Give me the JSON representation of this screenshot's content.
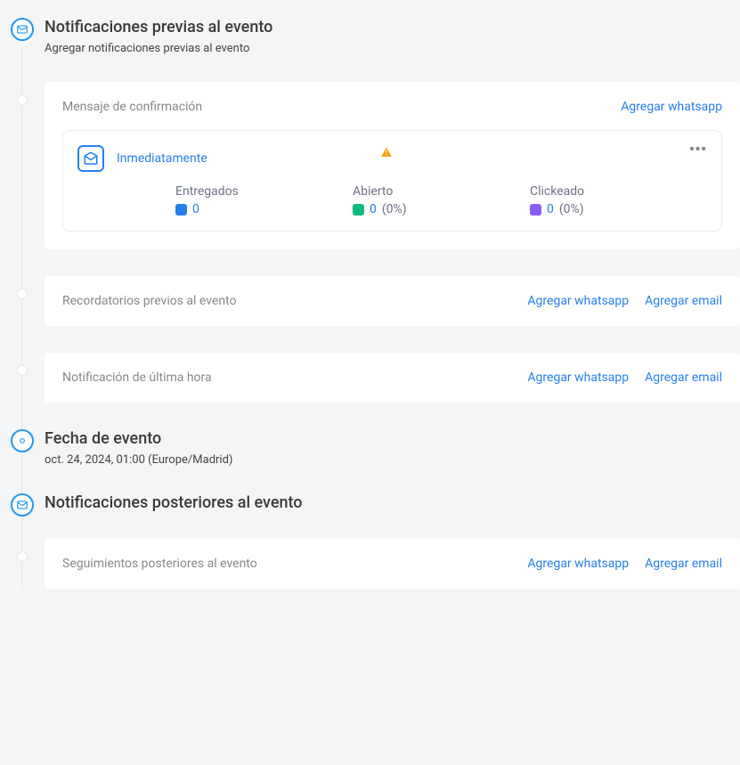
{
  "sections": {
    "pre": {
      "title": "Notificaciones previas al evento",
      "subtitle": "Agregar notificaciones previas al evento"
    },
    "event": {
      "title": "Fecha de evento",
      "date": "oct. 24, 2024, 01:00 (Europe/Madrid)"
    },
    "post": {
      "title": "Notificaciones posteriores al evento"
    }
  },
  "cards": {
    "confirmation": {
      "title": "Mensaje de confirmación",
      "add_whatsapp": "Agregar whatsapp"
    },
    "reminders": {
      "title": "Recordatorios previos al evento",
      "add_whatsapp": "Agregar whatsapp",
      "add_email": "Agregar email"
    },
    "last_minute": {
      "title": "Notificación de última hora",
      "add_whatsapp": "Agregar whatsapp",
      "add_email": "Agregar email"
    },
    "followups": {
      "title": "Seguimientos posteriores al evento",
      "add_whatsapp": "Agregar whatsapp",
      "add_email": "Agregar email"
    }
  },
  "message": {
    "timing": "Inmediatamente",
    "stats": {
      "delivered": {
        "label": "Entregados",
        "value": "0"
      },
      "opened": {
        "label": "Abierto",
        "value": "0",
        "pct": "(0%)"
      },
      "clicked": {
        "label": "Clickeado",
        "value": "0",
        "pct": "(0%)"
      }
    }
  }
}
